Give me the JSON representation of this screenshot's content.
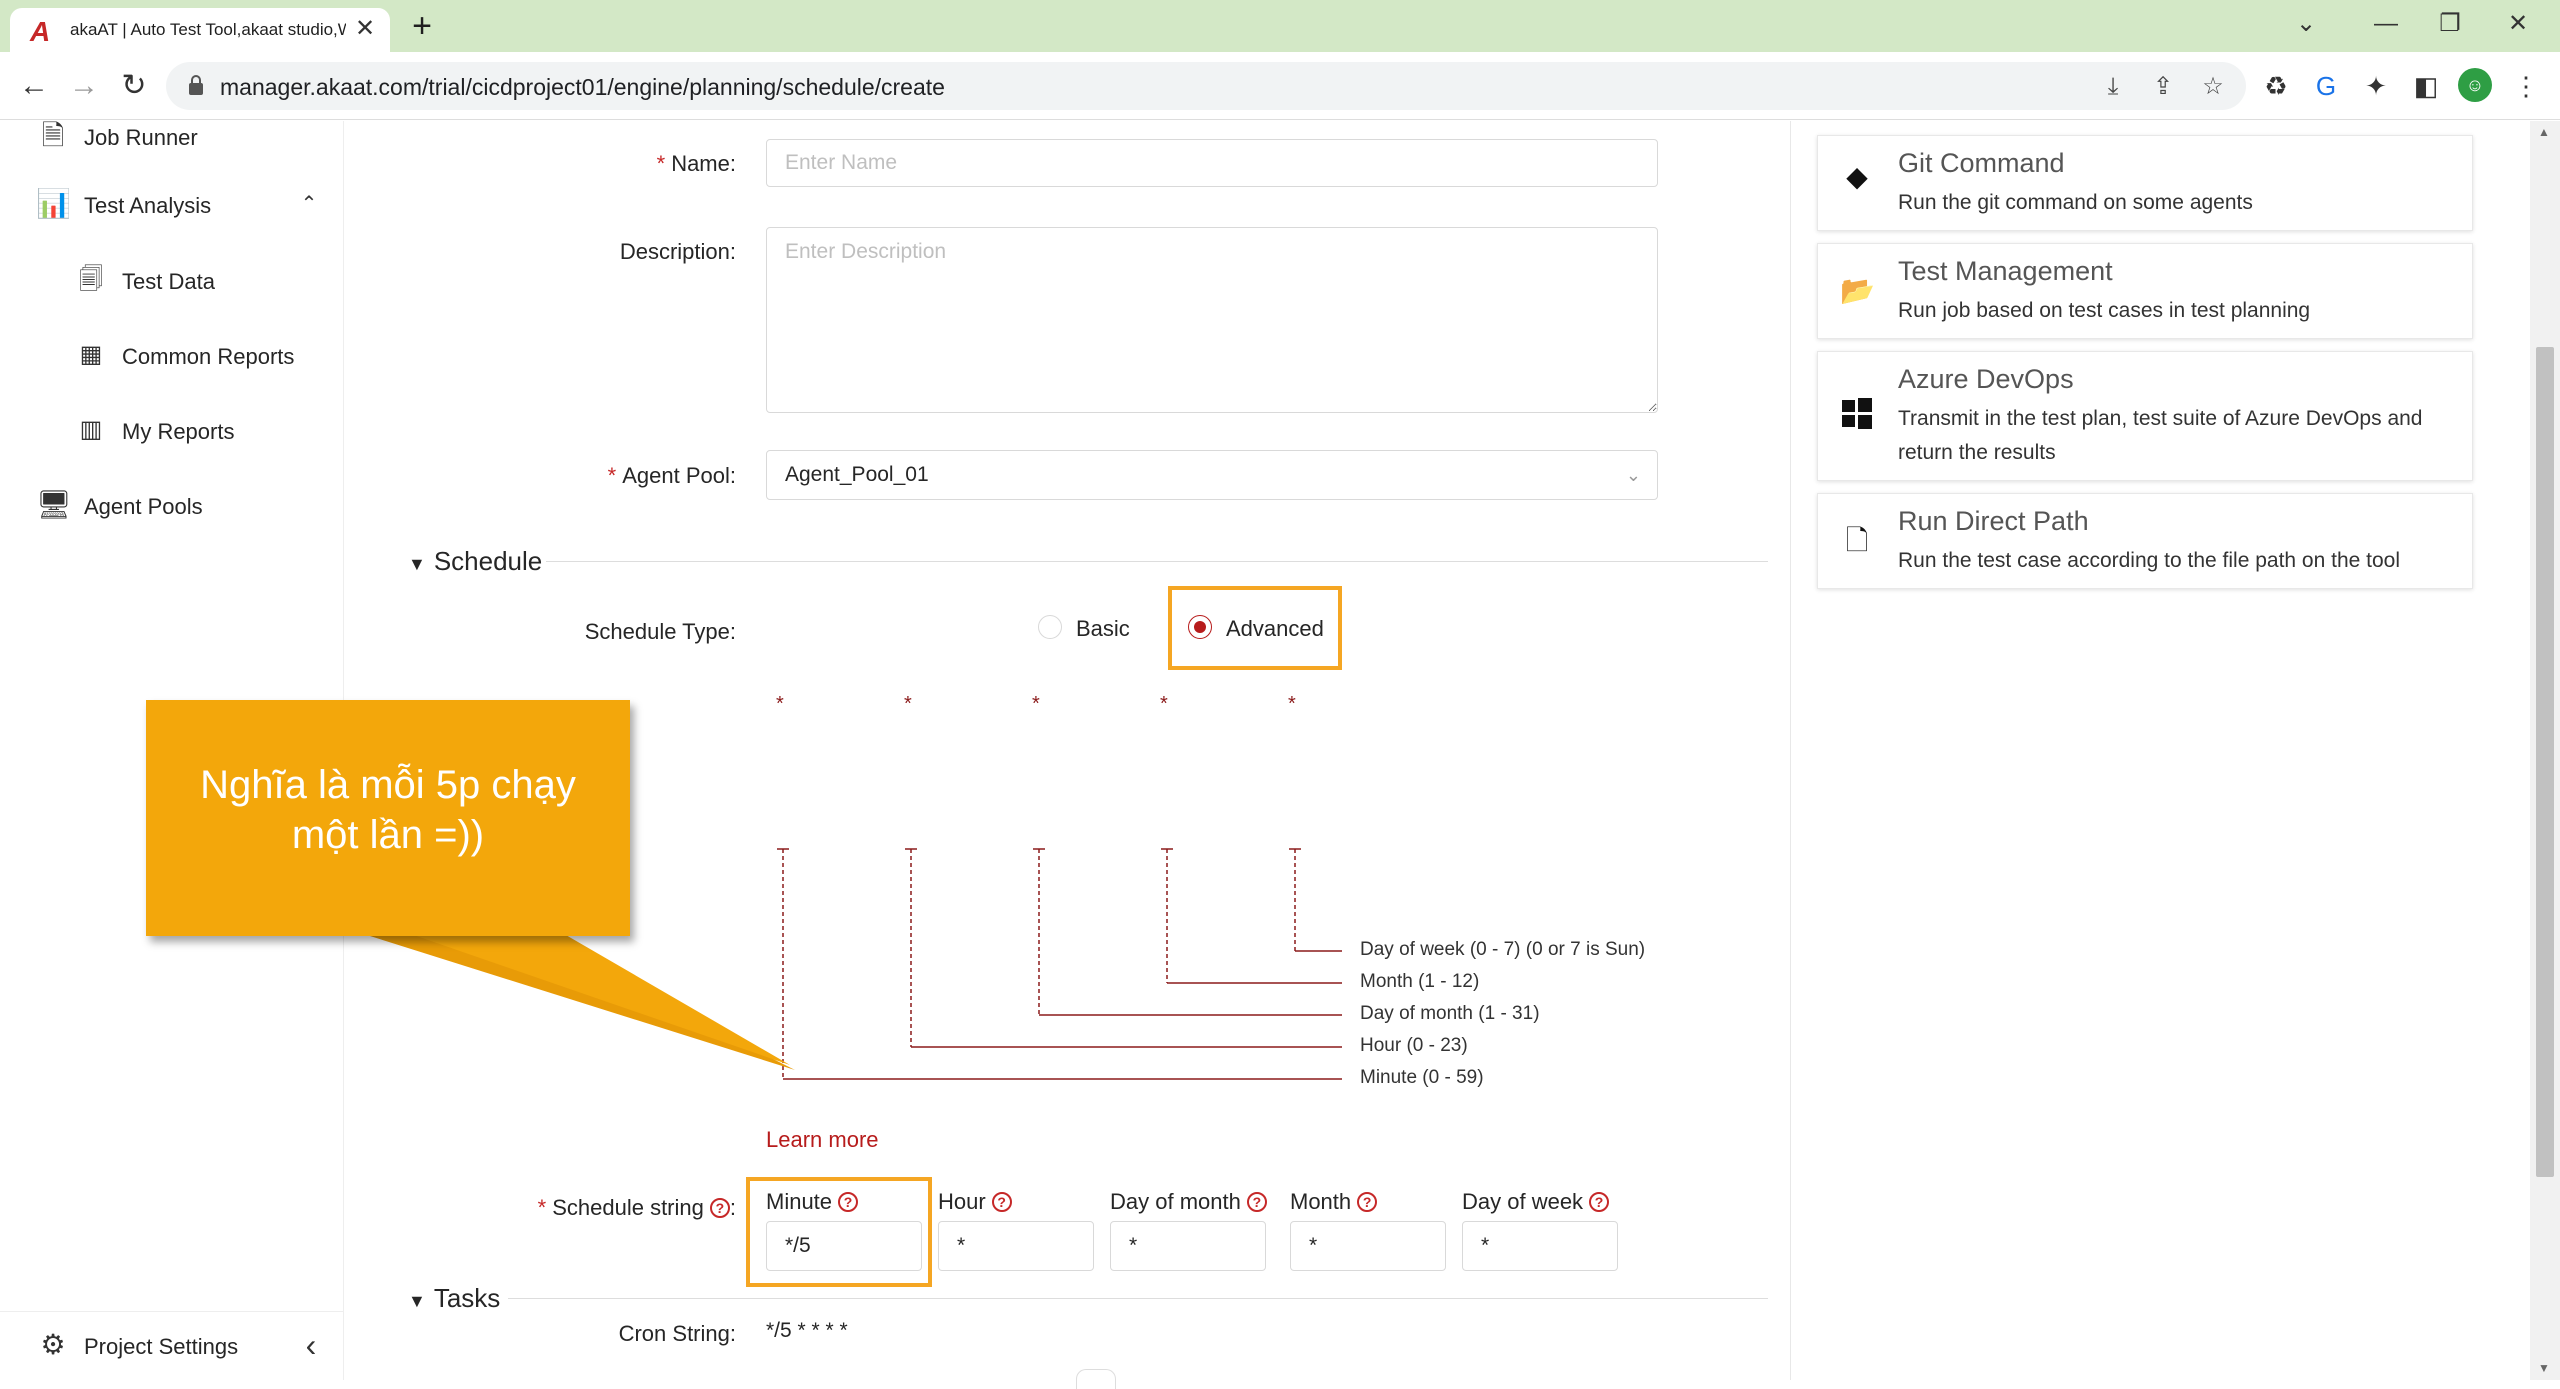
{
  "browser": {
    "tab_title": "akaAT | Auto Test Tool,akaat studio,Web",
    "url": "manager.akaat.com/trial/cicdproject01/engine/planning/schedule/create"
  },
  "sidebar": {
    "items": [
      {
        "label": "Job Runner"
      },
      {
        "label": "Test Analysis"
      },
      {
        "label": "Test Data"
      },
      {
        "label": "Common Reports"
      },
      {
        "label": "My Reports"
      },
      {
        "label": "Agent Pools"
      }
    ],
    "footer_label": "Project Settings"
  },
  "form": {
    "name_label": "Name",
    "name_placeholder": "Enter Name",
    "description_label": "Description",
    "description_placeholder": "Enter Description",
    "agent_pool_label": "Agent Pool",
    "agent_pool_value": "Agent_Pool_01",
    "schedule_section": "Schedule",
    "schedule_type_label": "Schedule Type",
    "schedule_type_options": [
      "Basic",
      "Advanced"
    ],
    "schedule_type_selected": "Advanced",
    "cron_diagram": {
      "stars": [
        "*",
        "*",
        "*",
        "*",
        "*"
      ],
      "labels": [
        "Day of week (0 - 7) (0 or 7 is Sun)",
        "Month (1 - 12)",
        "Day of month (1 - 31)",
        "Hour (0 - 23)",
        "Minute (0 - 59)"
      ]
    },
    "learn_more": "Learn more",
    "schedule_string_label": "Schedule string",
    "fields": [
      {
        "label": "Minute",
        "value": "*/5"
      },
      {
        "label": "Hour",
        "value": "*"
      },
      {
        "label": "Day of month",
        "value": "*"
      },
      {
        "label": "Month",
        "value": "*"
      },
      {
        "label": "Day of week",
        "value": "*"
      }
    ],
    "cron_string_label": "Cron String",
    "cron_string_value": "*/5 * * * *",
    "tasks_section": "Tasks"
  },
  "tasks_panel": [
    {
      "title": "Git Command",
      "desc": "Run the git command on some agents",
      "icon": "git-icon"
    },
    {
      "title": "Test Management",
      "desc": "Run job based on test cases in test planning",
      "icon": "folder-open-icon"
    },
    {
      "title": "Azure DevOps",
      "desc": "Transmit in the test plan, test suite of Azure DevOps and return the results",
      "icon": "windows-icon"
    },
    {
      "title": "Run Direct Path",
      "desc": "Run the test case according to the file path on the tool",
      "icon": "code-file-icon"
    }
  ],
  "callout": {
    "line1": "Nghĩa là mỗi 5p chạy",
    "line2": "một lần =))"
  },
  "colors": {
    "accent": "#b71c1c",
    "highlight": "#f5a623",
    "callout": "#f3a70b",
    "tabbar": "#d3e8c6"
  }
}
